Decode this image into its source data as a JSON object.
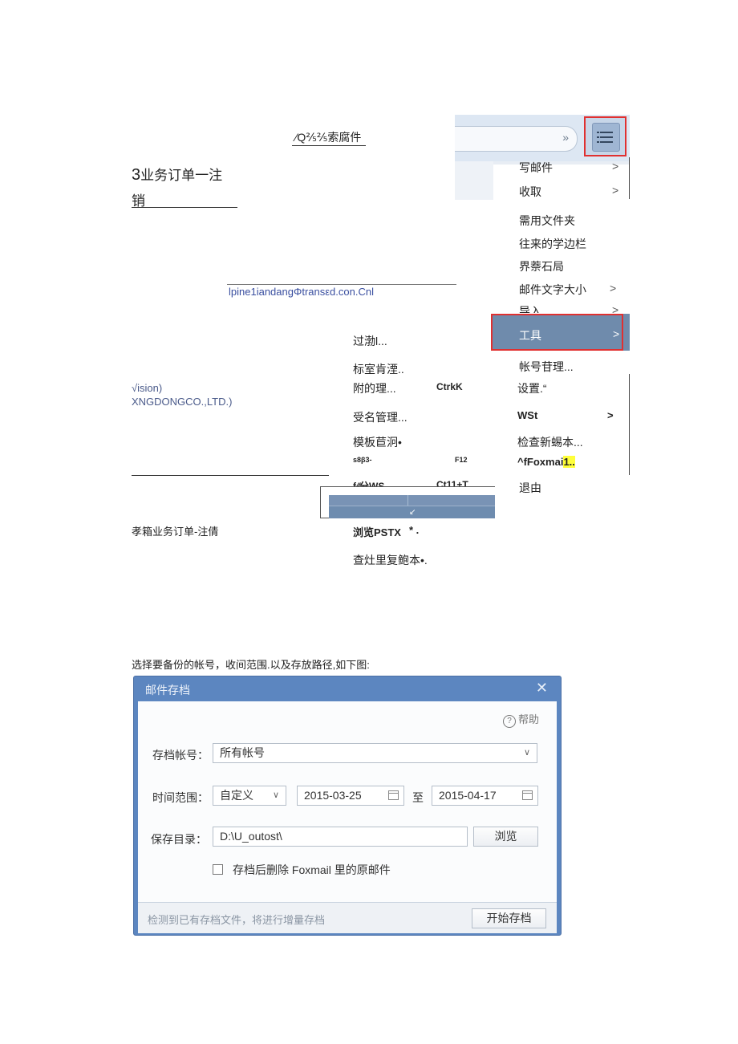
{
  "left_doc": {
    "header_link": "⁄Q⅖⅖索腐件",
    "section_title_line1": "3业务订单一注",
    "section_title_line2": "销",
    "url_text": "lpine1iandangΦtransεd.con.Cnl",
    "vision_line1": "√ision)",
    "vision_line2": "XNGDONGCO.,LTD.)",
    "mail_order_cancel": "孝箱业务订单-注倩",
    "instruction": "选择要备份的帐号，收间范围.以及存放路径,如下图:"
  },
  "tools_submenu": [
    {
      "label": "过渤l...",
      "shortcut": ""
    },
    {
      "label": "标室肯湮..",
      "shortcut": ""
    },
    {
      "label": "附的理...",
      "shortcut": "CtrkK"
    },
    {
      "label": "受名管理...",
      "shortcut": ""
    },
    {
      "label": "模板苣泂•",
      "shortcut": ""
    },
    {
      "label": "s8β3-",
      "shortcut": "F12"
    },
    {
      "label": "f⁄⁄分WS",
      "shortcut": "Ct11+T"
    },
    {
      "label": "浏览PSTX",
      "shortcut": "* ."
    },
    {
      "label": "查灶里复鲍本•.",
      "shortcut": ""
    }
  ],
  "main_menu": {
    "write_mail": "写邮件",
    "receive": "收取",
    "common_folders": "需用文件夹",
    "contacts_sidebar": "往来的学边栏",
    "layout": "界萘石局",
    "font_size": "邮件文字大小",
    "import": "导入",
    "tools": "工具",
    "account_mgmt": "帐号苷理...",
    "settings": "设置.“",
    "wst": "WSt",
    "check_update": "检查新蜴本...",
    "about_prefix": "^fFoxmai",
    "about_highlight": "1..",
    "exit": "退由",
    "arrow": ">"
  },
  "dialog": {
    "title": "邮件存档",
    "close": "✕",
    "help_icon_glyph": "?",
    "help": "帮助",
    "account_label": "存档帐号：",
    "account_value": "所有帐号",
    "time_label": "时间范围：",
    "time_mode": "自定义",
    "date_from": "2015-03-25",
    "to_label": "至",
    "date_to": "2015-04-17",
    "dir_label": "保存目录：",
    "dir_value": "D:\\U_outost\\",
    "browse": "浏览",
    "delete_checkbox_label": "存档后删除 Foxmail 里的原邮件",
    "delete_checked": false,
    "footer_note": "检测到已有存档文件，将进行增量存档",
    "start_button": "开始存档"
  },
  "colors": {
    "highlight_border": "#e03030",
    "menu_selected": "#6f8bac",
    "dialog_title_bar": "#5c86c0",
    "yellow_highlight": "#ffff3a"
  }
}
